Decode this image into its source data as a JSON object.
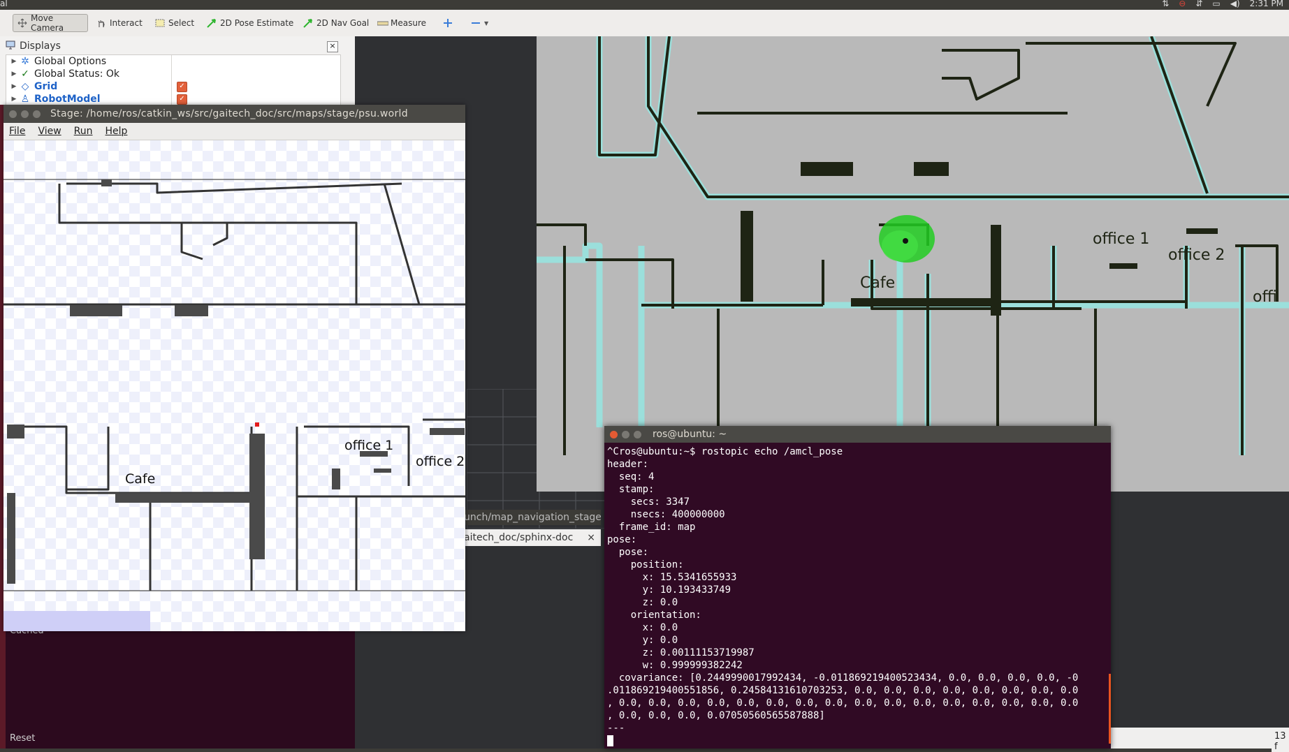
{
  "topbar": {
    "app_label": "al",
    "time": "2:31 PM"
  },
  "rviz_toolbar": {
    "tools": [
      {
        "label": "Move Camera",
        "icon": "move-camera-icon"
      },
      {
        "label": "Interact",
        "icon": "hand-icon"
      },
      {
        "label": "Select",
        "icon": "select-box-icon"
      },
      {
        "label": "2D Pose Estimate",
        "icon": "green-arrow-icon"
      },
      {
        "label": "2D Nav Goal",
        "icon": "green-arrow-icon"
      },
      {
        "label": "Measure",
        "icon": "ruler-icon"
      }
    ]
  },
  "displays": {
    "title": "Displays",
    "close_label": "×",
    "items": [
      {
        "label": "Global Options",
        "icon": "gear-icon",
        "checked": false
      },
      {
        "label": "Global Status: Ok",
        "icon": "checkmark-icon",
        "checked": false
      },
      {
        "label": "Grid",
        "icon": "grid-icon",
        "checked": true
      },
      {
        "label": "RobotModel",
        "icon": "robot-icon",
        "checked": true
      }
    ]
  },
  "stage": {
    "title": "Stage: /home/ros/catkin_ws/src/gaitech_doc/src/maps/stage/psu.world",
    "menu": [
      "File",
      "View",
      "Run",
      "Help"
    ],
    "room_labels": [
      "Cafe",
      "office 1",
      "office 2"
    ]
  },
  "rviz_map": {
    "room_labels": [
      "office 1",
      "office 2",
      "Cafe",
      "offi"
    ]
  },
  "background_terminals": {
    "tab1": "unch/map_navigation_stage",
    "tab2": "aitech_doc/sphinx-doc",
    "tab2_close": "×",
    "cached": "Cached",
    "reset": "Reset",
    "status_count": "13 f"
  },
  "terminal": {
    "title": "ros@ubuntu: ~",
    "output": "^Cros@ubuntu:~$ rostopic echo /amcl_pose\nheader:\n  seq: 4\n  stamp:\n    secs: 3347\n    nsecs: 400000000\n  frame_id: map\npose:\n  pose:\n    position:\n      x: 15.5341655933\n      y: 10.193433749\n      z: 0.0\n    orientation:\n      x: 0.0\n      y: 0.0\n      z: 0.00111153719987\n      w: 0.999999382242\n  covariance: [0.2449990017992434, -0.011869219400523434, 0.0, 0.0, 0.0, 0.0, -0\n.011869219400551856, 0.24584131610703253, 0.0, 0.0, 0.0, 0.0, 0.0, 0.0, 0.0, 0.0\n, 0.0, 0.0, 0.0, 0.0, 0.0, 0.0, 0.0, 0.0, 0.0, 0.0, 0.0, 0.0, 0.0, 0.0, 0.0, 0.0\n, 0.0, 0.0, 0.0, 0.07050560565587888]\n---\n"
  },
  "colors": {
    "terminal_bg": "#300a24",
    "accent_orange": "#e95420",
    "map_wall": "#1e2414",
    "map_free": "#b9b9b9",
    "map_halo": "#8ff0ea",
    "particle_green": "#22cc22"
  }
}
